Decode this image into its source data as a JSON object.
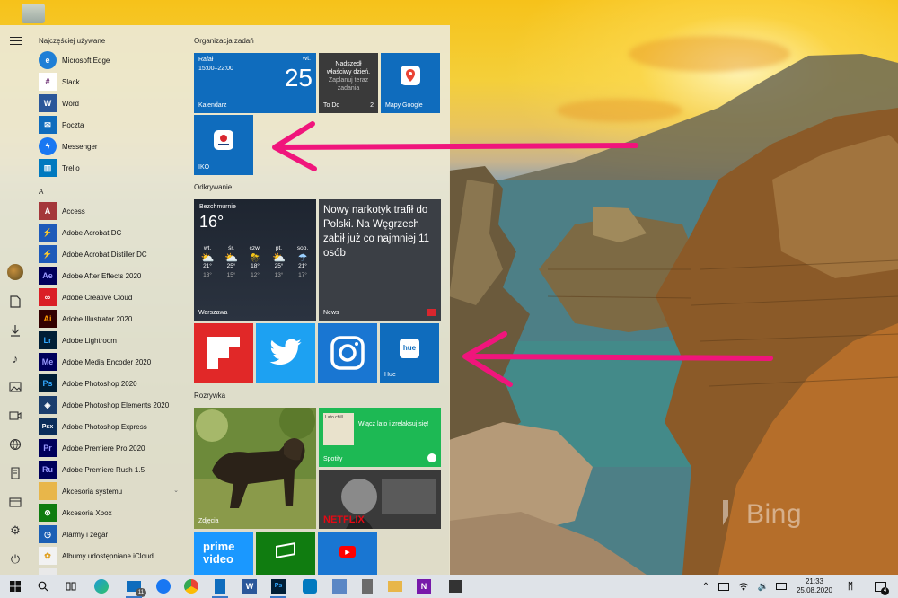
{
  "start_menu": {
    "recent_header": "Najczęściej używane",
    "recent": [
      {
        "label": "Microsoft Edge",
        "icon": "edge-icon",
        "color": "#1e7fd6"
      },
      {
        "label": "Slack",
        "icon": "slack-icon",
        "color": "#ffffff"
      },
      {
        "label": "Word",
        "icon": "word-icon",
        "color": "#2b579a"
      },
      {
        "label": "Poczta",
        "icon": "mail-icon",
        "color": "#0f6cbd"
      },
      {
        "label": "Messenger",
        "icon": "messenger-icon",
        "color": "#1877f2"
      },
      {
        "label": "Trello",
        "icon": "trello-icon",
        "color": "#0079bf"
      }
    ],
    "letter_a": "A",
    "apps": [
      {
        "label": "Access",
        "icon": "access-icon",
        "color": "#a4373a",
        "glyph": "A"
      },
      {
        "label": "Adobe Acrobat DC",
        "icon": "acrobat-icon",
        "color": "#1e5ab9",
        "glyph": "⚡"
      },
      {
        "label": "Adobe Acrobat Distiller DC",
        "icon": "distiller-icon",
        "color": "#1e5ab9",
        "glyph": "⚡"
      },
      {
        "label": "Adobe After Effects 2020",
        "icon": "after-effects-icon",
        "color": "#00005b",
        "glyph": "Ae"
      },
      {
        "label": "Adobe Creative Cloud",
        "icon": "creative-cloud-icon",
        "color": "#da1f26",
        "glyph": "∞"
      },
      {
        "label": "Adobe Illustrator 2020",
        "icon": "illustrator-icon",
        "color": "#330000",
        "glyph": "Ai"
      },
      {
        "label": "Adobe Lightroom",
        "icon": "lightroom-icon",
        "color": "#001e36",
        "glyph": "Lr"
      },
      {
        "label": "Adobe Media Encoder 2020",
        "icon": "media-encoder-icon",
        "color": "#00005b",
        "glyph": "Me"
      },
      {
        "label": "Adobe Photoshop 2020",
        "icon": "photoshop-icon",
        "color": "#001e36",
        "glyph": "Ps"
      },
      {
        "label": "Adobe Photoshop Elements 2020",
        "icon": "photoshop-elements-icon",
        "color": "#1b3e6e",
        "glyph": "◈"
      },
      {
        "label": "Adobe Photoshop Express",
        "icon": "photoshop-express-icon",
        "color": "#0a2d5a",
        "glyph": "Psx"
      },
      {
        "label": "Adobe Premiere Pro 2020",
        "icon": "premiere-pro-icon",
        "color": "#00005b",
        "glyph": "Pr"
      },
      {
        "label": "Adobe Premiere Rush 1.5",
        "icon": "premiere-rush-icon",
        "color": "#00005b",
        "glyph": "Ru"
      },
      {
        "label": "Akcesoria systemu",
        "icon": "folder-icon",
        "color": "#e8b64a",
        "glyph": ""
      },
      {
        "label": "Akcesoria Xbox",
        "icon": "xbox-icon",
        "color": "#107c10",
        "glyph": "⊗"
      },
      {
        "label": "Alarmy i zegar",
        "icon": "alarm-clock-icon",
        "color": "#1b5fb5",
        "glyph": "◷"
      },
      {
        "label": "Albumy udostępniane iCloud",
        "icon": "icloud-albums-icon",
        "color": "#f2f2f2",
        "glyph": "✿"
      }
    ],
    "groups": {
      "organizacja": "Organizacja zadań",
      "odkrywanie": "Odkrywanie",
      "rozrywka": "Rozrywka"
    },
    "tiles": {
      "calendar": {
        "user": "Rafał",
        "time": "15:00–22:00",
        "day_name": "wt.",
        "day": "25",
        "label": "Kalendarz"
      },
      "todo": {
        "line1": "Nadszedł",
        "line2": "właściwy dzień.",
        "line3": "Zaplanuj teraz",
        "line4": "zadania",
        "label": "To Do",
        "count": "2"
      },
      "maps": {
        "label": "Mapy Google"
      },
      "iko": {
        "label": "IKO"
      },
      "weather": {
        "condition": "Bezchmurnie",
        "temp": "16°",
        "city": "Warszawa",
        "days": [
          {
            "d": "wt.",
            "hi": "21°",
            "lo": "13°"
          },
          {
            "d": "śr.",
            "hi": "25°",
            "lo": "15°"
          },
          {
            "d": "czw.",
            "hi": "18°",
            "lo": "12°"
          },
          {
            "d": "pt.",
            "hi": "25°",
            "lo": "13°"
          },
          {
            "d": "sob.",
            "hi": "21°",
            "lo": "17°"
          }
        ]
      },
      "news": {
        "headline": "Nowy narkotyk trafił do Polski. Na Węgrzech zabił już co najmniej 11 osób",
        "label": "News"
      },
      "hue": {
        "label": "Hue",
        "logo": "hue"
      },
      "photos": {
        "label": "Zdjęcia"
      },
      "spotify": {
        "label": "Spotify",
        "text": "Włącz lato i zrelaksuj się!",
        "album": "Lato chill"
      },
      "netflix": {
        "label": "NETFLIX"
      },
      "prime": {
        "line1": "prime",
        "line2": "video"
      }
    }
  },
  "desktop": {
    "watermark": "Bing"
  },
  "taskbar": {
    "mail_badge": "11",
    "time": "21:33",
    "date": "25.08.2020",
    "notification_count": "4"
  }
}
